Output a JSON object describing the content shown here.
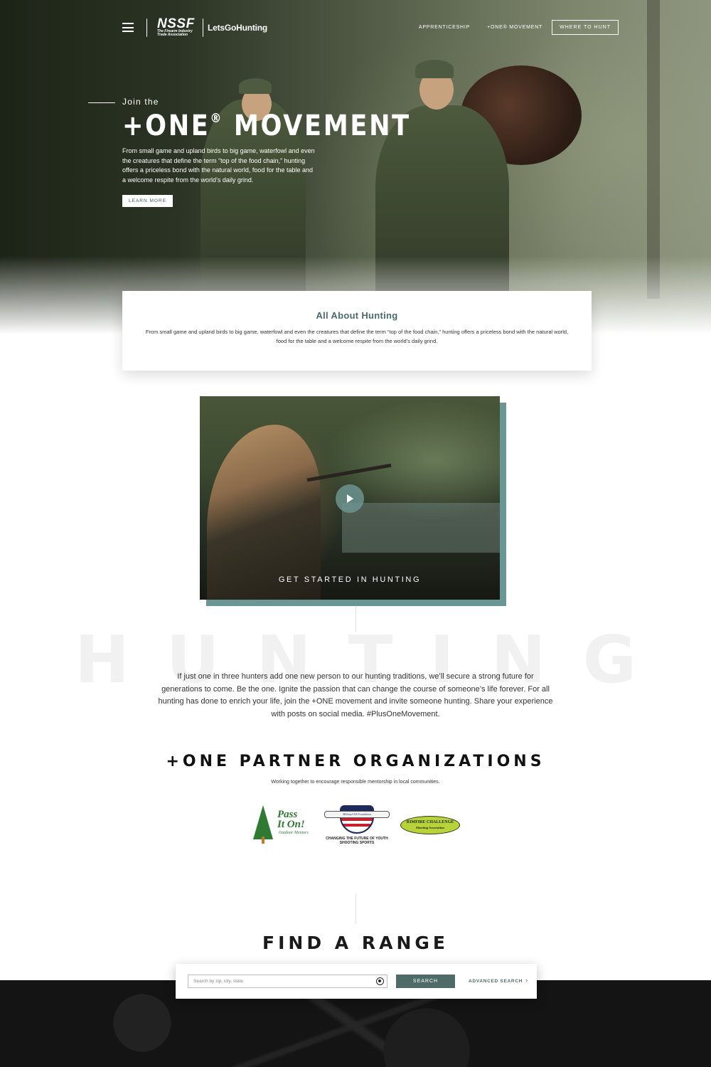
{
  "header": {
    "logo_primary": "NSSF",
    "logo_subtitle": "The Firearm Industry Trade Association",
    "logo_secondary": "LetsGoHunting",
    "nav": [
      {
        "label": "APPRENTICESHIP"
      },
      {
        "label": "+ONE® MOVEMENT"
      }
    ],
    "cta_label": "WHERE TO HUNT"
  },
  "hero": {
    "kicker": "Join the",
    "title_prefix": "+ONE",
    "title_mark": "®",
    "title_suffix": " MOVEMENT",
    "body": "From small game and upland birds to big game, waterfowl and even the creatures that define the term “top of the food chain,” hunting offers a priceless bond with the natural world, food for the table and a welcome respite from the world’s daily grind.",
    "button_label": "LEARN MORE"
  },
  "about": {
    "title": "All About Hunting",
    "body": "From small game and upland birds to big game, waterfowl and even the creatures that define the term “top of the food chain,” hunting offers a priceless bond with the natural world, food for the table and a welcome respite from the world’s daily grind."
  },
  "video": {
    "label": "GET STARTED IN HUNTING"
  },
  "hunting": {
    "background_word": "HUNTING",
    "body": "If just one in three hunters add one new person to our hunting traditions, we’ll secure a strong future for generations to come. Be the one. Ignite the passion that can change the course of someone’s life forever. For all hunting has done to enrich your life, join the +ONE movement and invite someone hunting. Share your experience with posts on social media. #PlusOneMovement."
  },
  "partners": {
    "title": "+ONE PARTNER ORGANIZATIONS",
    "subtitle": "Working together to encourage responsible mentorship in local communities.",
    "logos": [
      {
        "name": "Pass It On!",
        "line1": "Pass",
        "line2": "It On!",
        "tagline": "Outdoor Mentors"
      },
      {
        "name": "MidwayUSA Foundation",
        "ribbon": "MidwayUSA Foundation",
        "tagline": "CHANGING THE FUTURE OF YOUTH SHOOTING SPORTS"
      },
      {
        "name": "Rimfire Challenge Shooting Association",
        "line1": "RIMFIRE CHALLENGE",
        "line2": "Shooting Association"
      }
    ]
  },
  "range": {
    "title": "FIND A RANGE",
    "search_placeholder": "Search by zip, city, state",
    "search_value": "",
    "search_button": "SEARCH",
    "advanced_label": "ADVANCED SEARCH",
    "advanced_chevron": "›"
  },
  "colors": {
    "accent_teal": "#4e6b6a",
    "video_frame": "#6a9693",
    "about_title": "#4a6b68"
  },
  "icons": [
    "menu-icon",
    "play-icon",
    "locate-icon",
    "chevron-right-icon"
  ]
}
